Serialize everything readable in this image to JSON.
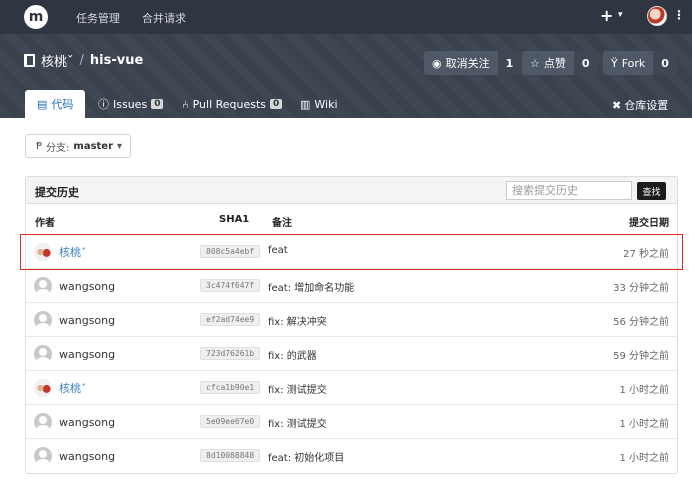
{
  "topnav": {
    "logo": "m",
    "links": [
      "任务管理",
      "合并请求"
    ],
    "plus": "+",
    "caret": "▾",
    "kebab": "⋮"
  },
  "repo": {
    "owner": "核桃ˇ",
    "separator": "/",
    "name": "his-vue",
    "unwatch": {
      "label": "取消关注",
      "count": "1"
    },
    "star": {
      "label": "点赞",
      "count": "0"
    },
    "fork": {
      "label": "Fork",
      "count": "0"
    }
  },
  "tabs": [
    {
      "label": "代码",
      "badge": ""
    },
    {
      "label": "Issues",
      "badge": "0"
    },
    {
      "label": "Pull Requests",
      "badge": "0"
    },
    {
      "label": "Wiki",
      "badge": ""
    }
  ],
  "settings_label": "仓库设置",
  "branch": {
    "prefix": "分支:",
    "name": "master"
  },
  "history": {
    "title": "提交历史",
    "search_placeholder": "搜索提交历史",
    "search_button": "查找",
    "columns": {
      "author": "作者",
      "sha": "SHA1",
      "message": "备注",
      "date": "提交日期"
    },
    "rows": [
      {
        "author": "核桃ˇ",
        "sha": "808c5a4ebf",
        "message": "feat",
        "date": "27 秒之前"
      },
      {
        "author": "wangsong",
        "sha": "3c474f647f",
        "message": "feat: 增加命名功能",
        "date": "33 分钟之前"
      },
      {
        "author": "wangsong",
        "sha": "ef2ad74ee9",
        "message": "fix: 解决冲突",
        "date": "56 分钟之前"
      },
      {
        "author": "wangsong",
        "sha": "723d76261b",
        "message": "fix: 的武器",
        "date": "59 分钟之前"
      },
      {
        "author": "核桃ˇ",
        "sha": "cfca1b90e1",
        "message": "fix: 测试提交",
        "date": "1 小时之前"
      },
      {
        "author": "wangsong",
        "sha": "5e09ee67e0",
        "message": "fix: 测试提交",
        "date": "1 小时之前"
      },
      {
        "author": "wangsong",
        "sha": "8d10088848",
        "message": "feat: 初始化项目",
        "date": "1 小时之前"
      }
    ]
  }
}
